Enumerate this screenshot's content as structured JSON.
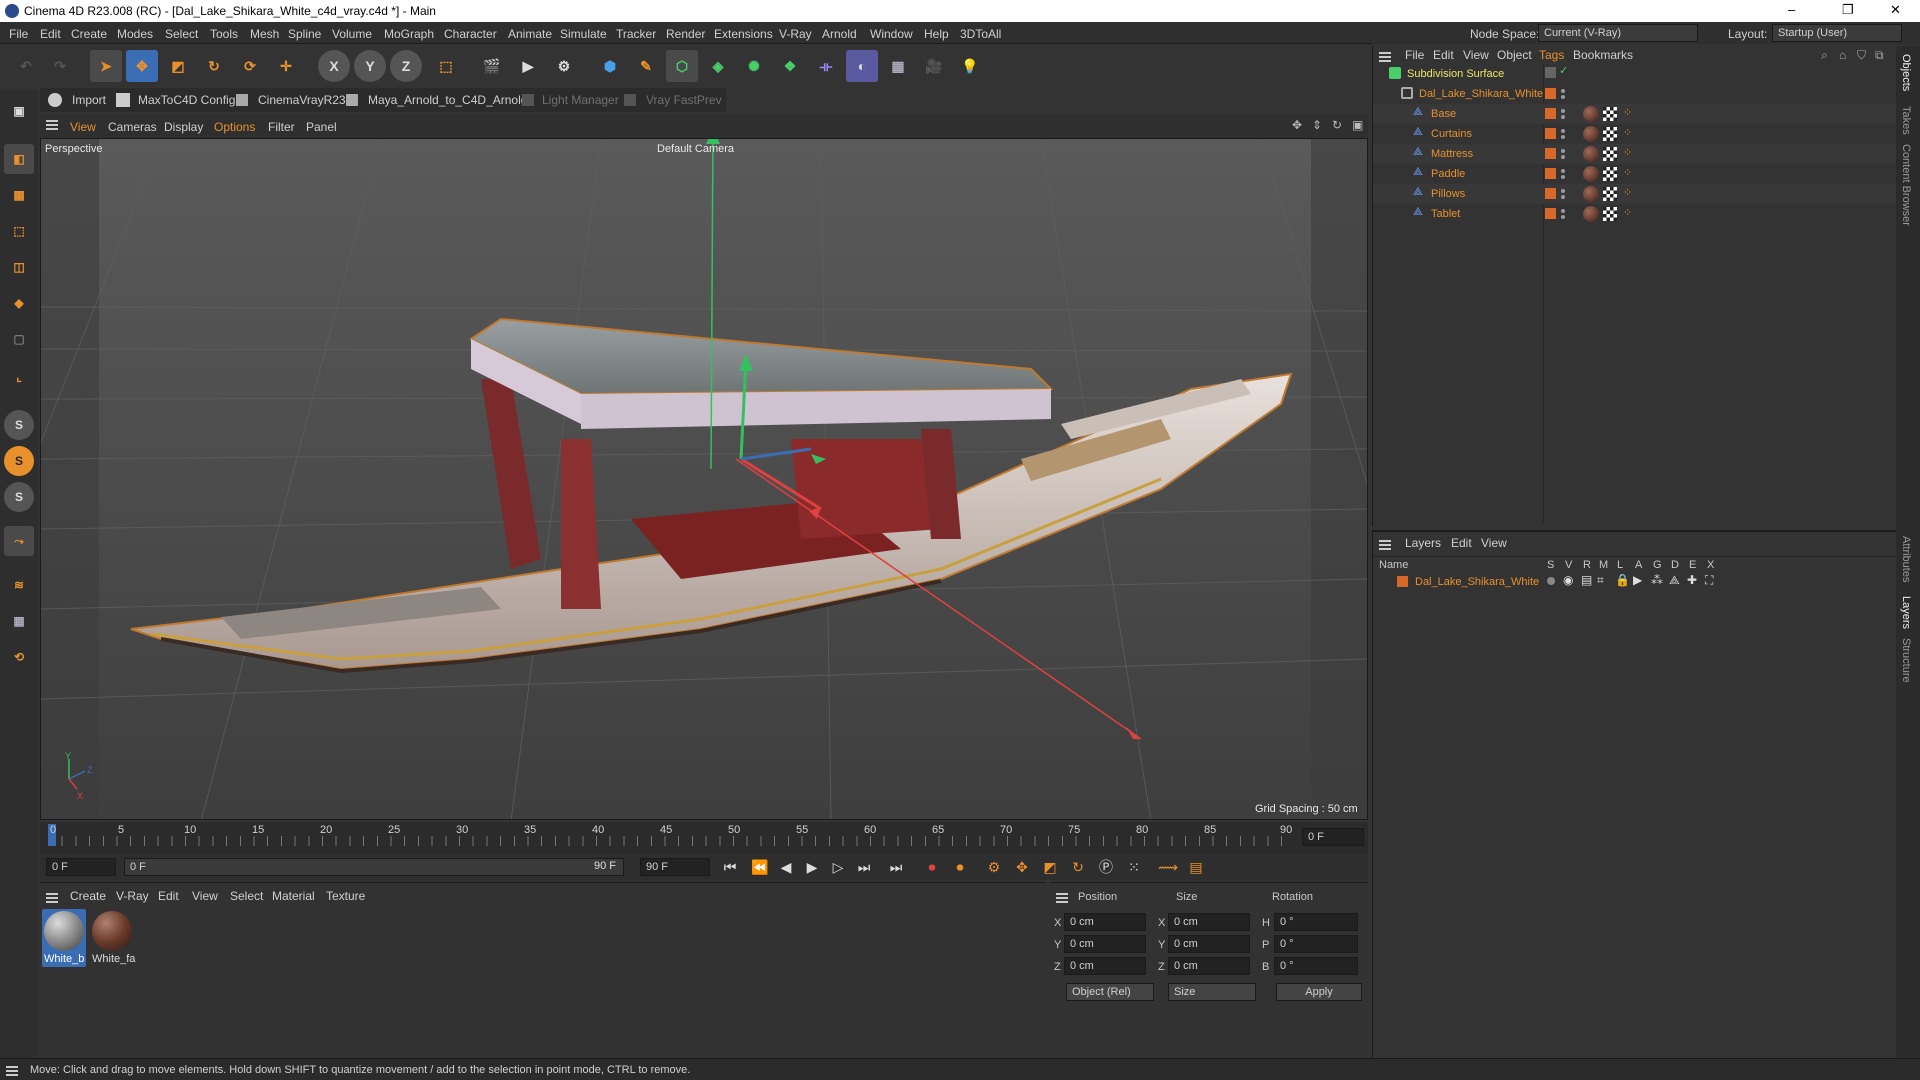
{
  "window": {
    "title": "Cinema 4D R23.008 (RC) - [Dal_Lake_Shikara_White_c4d_vray.c4d *] - Main",
    "controls": [
      "–",
      "❐",
      "✕"
    ]
  },
  "menu": [
    "File",
    "Edit",
    "Create",
    "Modes",
    "Select",
    "Tools",
    "Mesh",
    "Spline",
    "Volume",
    "MoGraph",
    "Character",
    "Animate",
    "Simulate",
    "Tracker",
    "Render",
    "Extensions",
    "V-Ray",
    "Arnold",
    "Window",
    "Help",
    "3DToAll"
  ],
  "node_space": {
    "label": "Node Space:",
    "value": "Current (V-Ray)"
  },
  "layout": {
    "label": "Layout:",
    "value": "Startup (User)"
  },
  "plugin_bar": [
    "Import",
    "MaxToC4D Config",
    "CinemaVrayR23",
    "Maya_Arnold_to_C4D_Arnold",
    "Light Manager",
    "Vray FastPrev"
  ],
  "viewport_menu": [
    "View",
    "Cameras",
    "Display",
    "Options",
    "Filter",
    "Panel"
  ],
  "viewport": {
    "name": "Perspective",
    "camera": "Default Camera",
    "grid_spacing": "Grid Spacing : 50 cm",
    "axis_labels": {
      "y": "Y",
      "x": "X",
      "z": "Z"
    }
  },
  "timeline": {
    "ticks": [
      "0",
      "5",
      "10",
      "15",
      "20",
      "25",
      "30",
      "35",
      "40",
      "45",
      "50",
      "55",
      "60",
      "65",
      "70",
      "75",
      "80",
      "85",
      "90"
    ],
    "current_frame_box": "0 F"
  },
  "transport": {
    "start": "0 F",
    "preview_start": "0 F",
    "preview_end": "90 F",
    "end": "90 F"
  },
  "material_manager": {
    "menu": [
      "Create",
      "V-Ray",
      "Edit",
      "View",
      "Select",
      "Material",
      "Texture"
    ],
    "materials": [
      {
        "name": "White_b",
        "selected": true
      },
      {
        "name": "White_fa",
        "selected": false
      }
    ]
  },
  "attributes": {
    "headers": [
      "Position",
      "Size",
      "Rotation"
    ],
    "rows": [
      {
        "axis": "X",
        "pos": "0 cm",
        "saxis": "X",
        "size": "0 cm",
        "raxis": "H",
        "rot": "0 °"
      },
      {
        "axis": "Y",
        "pos": "0 cm",
        "saxis": "Y",
        "size": "0 cm",
        "raxis": "P",
        "rot": "0 °"
      },
      {
        "axis": "Z",
        "pos": "0 cm",
        "saxis": "Z",
        "size": "0 cm",
        "raxis": "B",
        "rot": "0 °"
      }
    ],
    "coord_mode": "Object (Rel)",
    "size_mode": "Size",
    "apply": "Apply"
  },
  "object_manager": {
    "menu": [
      "File",
      "Edit",
      "View",
      "Object",
      "Tags",
      "Bookmarks"
    ],
    "objects": [
      {
        "name": "Subdivision Surface",
        "level": 0,
        "type": "subdivision"
      },
      {
        "name": "Dal_Lake_Shikara_White",
        "level": 1,
        "type": "null"
      },
      {
        "name": "Base",
        "level": 2,
        "type": "poly"
      },
      {
        "name": "Curtains",
        "level": 2,
        "type": "poly"
      },
      {
        "name": "Mattress",
        "level": 2,
        "type": "poly"
      },
      {
        "name": "Paddle",
        "level": 2,
        "type": "poly"
      },
      {
        "name": "Pillows",
        "level": 2,
        "type": "poly"
      },
      {
        "name": "Tablet",
        "level": 2,
        "type": "poly"
      }
    ]
  },
  "layer_manager": {
    "menu": [
      "Layers",
      "Edit",
      "View"
    ],
    "columns": [
      "Name",
      "S",
      "V",
      "R",
      "M",
      "L",
      "A",
      "G",
      "D",
      "E",
      "X"
    ],
    "layers": [
      {
        "name": "Dal_Lake_Shikara_White",
        "color": "#d8682a"
      }
    ]
  },
  "side_tabs": [
    "Objects",
    "Takes",
    "Content Browser",
    "Attributes",
    "Layers",
    "Structure"
  ],
  "status": "Move: Click and drag to move elements. Hold down SHIFT to quantize movement / add to the selection in point mode, CTRL to remove.",
  "colors": {
    "accent": "#e8912c",
    "layer": "#d8682a",
    "selection_blue": "#3a6db4"
  }
}
